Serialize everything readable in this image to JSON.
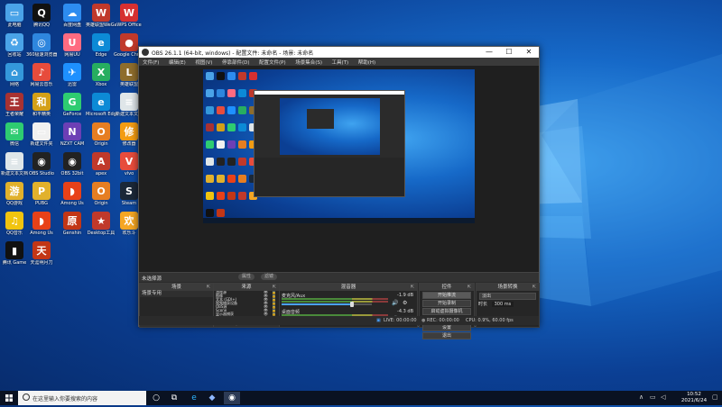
{
  "desktop": {
    "icons": [
      {
        "label": "此电脑",
        "icon": "computer-icon",
        "color": "#4aa3e8",
        "glyph": "▭"
      },
      {
        "label": "腾讯QQ",
        "icon": "qq-icon",
        "color": "#111111",
        "glyph": "Q"
      },
      {
        "label": "百度网盘",
        "icon": "baidu-netdisk-icon",
        "color": "#2d8cf0",
        "glyph": "☁"
      },
      {
        "label": "英雄联盟WeGame版",
        "icon": "wegame-icon",
        "color": "#c0392b",
        "glyph": "W"
      },
      {
        "label": "WPS Office",
        "icon": "wps-icon",
        "color": "#d63031",
        "glyph": "W"
      },
      {
        "label": "回收站",
        "icon": "recycle-bin-icon",
        "color": "#4aa3e8",
        "glyph": "♻"
      },
      {
        "label": "360极速浏览器",
        "icon": "browser-360-icon",
        "color": "#2e86de",
        "glyph": "◎"
      },
      {
        "label": "网易UU",
        "icon": "uu-icon",
        "color": "#ff6b81",
        "glyph": "U"
      },
      {
        "label": "Edge",
        "icon": "edge-icon",
        "color": "#0c8ad6",
        "glyph": "e"
      },
      {
        "label": "Google Chrome",
        "icon": "chrome-icon",
        "color": "#c0392b",
        "glyph": "●"
      },
      {
        "label": "网络",
        "icon": "network-icon",
        "color": "#3498db",
        "glyph": "⌂"
      },
      {
        "label": "网易云音乐",
        "icon": "netease-music-icon",
        "color": "#e74c3c",
        "glyph": "♪"
      },
      {
        "label": "迅雷",
        "icon": "thunder-icon",
        "color": "#1e90ff",
        "glyph": "✈"
      },
      {
        "label": "Xbox",
        "icon": "xbox-icon",
        "color": "#27ae60",
        "glyph": "X"
      },
      {
        "label": "英雄联盟",
        "icon": "lol-icon",
        "color": "#8e6d2c",
        "glyph": "L"
      },
      {
        "label": "王者荣耀",
        "icon": "honor-icon",
        "color": "#a83232",
        "glyph": "王"
      },
      {
        "label": "和平精英",
        "icon": "peace-elite-icon",
        "color": "#d4a017",
        "glyph": "和"
      },
      {
        "label": "GeForce",
        "icon": "geforce-icon",
        "color": "#2ecc71",
        "glyph": "G"
      },
      {
        "label": "Microsoft Edge",
        "icon": "edge-icon-2",
        "color": "#0c8ad6",
        "glyph": "e"
      },
      {
        "label": "新建文本文档",
        "icon": "text-file-icon",
        "color": "#dfe6e9",
        "glyph": "≡"
      },
      {
        "label": "微信",
        "icon": "wechat-icon",
        "color": "#2ecc71",
        "glyph": "✉"
      },
      {
        "label": "新建文件夹",
        "icon": "folder-icon",
        "color": "#f0f0f0",
        "glyph": "▭"
      },
      {
        "label": "NZXT CAM",
        "icon": "nzxt-icon",
        "color": "#6c3fb5",
        "glyph": "N"
      },
      {
        "label": "Origin",
        "icon": "origin-icon",
        "color": "#e67e22",
        "glyph": "O"
      },
      {
        "label": "修改器",
        "icon": "trainer-icon",
        "color": "#f39c12",
        "glyph": "修"
      },
      {
        "label": "新建文本文档",
        "icon": "text-file-icon-2",
        "color": "#dfe6e9",
        "glyph": "≡"
      },
      {
        "label": "OBS Studio",
        "icon": "obs-icon",
        "color": "#222222",
        "glyph": "◉"
      },
      {
        "label": "OBS 32bit",
        "icon": "obs-icon-2",
        "color": "#222222",
        "glyph": "◉"
      },
      {
        "label": "apex",
        "icon": "apex-icon",
        "color": "#c0392b",
        "glyph": "A"
      },
      {
        "label": "vivo",
        "icon": "game-icon",
        "color": "#e74c3c",
        "glyph": "V"
      },
      {
        "label": "QQ游戏",
        "icon": "qq-game-icon",
        "color": "#e1b12c",
        "glyph": "游"
      },
      {
        "label": "PUBG",
        "icon": "pubg-icon",
        "color": "#e1b12c",
        "glyph": "P"
      },
      {
        "label": "Among Us",
        "icon": "among-us-icon",
        "color": "#e84118",
        "glyph": "◗"
      },
      {
        "label": "Origin",
        "icon": "origin-icon-2",
        "color": "#e67e22",
        "glyph": "O"
      },
      {
        "label": "Steam",
        "icon": "steam-icon",
        "color": "#1b2838",
        "glyph": "S"
      },
      {
        "label": "QQ音乐",
        "icon": "qq-music-icon",
        "color": "#f1c40f",
        "glyph": "♫"
      },
      {
        "label": "Among Us",
        "icon": "among-us-icon-2",
        "color": "#e84118",
        "glyph": "◗"
      },
      {
        "label": "Genshin",
        "icon": "genshin-icon",
        "color": "#c23616",
        "glyph": "原"
      },
      {
        "label": "Desktop工具",
        "icon": "tool-icon",
        "color": "#c0392b",
        "glyph": "★"
      },
      {
        "label": "欢乐斗",
        "icon": "game-icon-2",
        "color": "#f5a623",
        "glyph": "欢"
      },
      {
        "label": "腾讯 Game",
        "icon": "tencent-game-icon",
        "color": "#111111",
        "glyph": "▮"
      },
      {
        "label": "天涯明月刀",
        "icon": "game-icon-3",
        "color": "#c23616",
        "glyph": "天"
      }
    ]
  },
  "obs": {
    "title": "OBS 26.1.1 (64-bit, windows) - 配置文件: 未命名 - 场景: 未命名",
    "minimize": "—",
    "maximize": "☐",
    "close": "✕",
    "menu": [
      "文件(F)",
      "编辑(E)",
      "视图(V)",
      "停靠部件(D)",
      "配置文件(P)",
      "场景集合(S)",
      "工具(T)",
      "帮助(H)"
    ],
    "no_source": "未选择源",
    "props_btn": "属性",
    "filters_btn": "滤镜",
    "docks": {
      "scenes": {
        "title": "场景",
        "items": [
          "场景专用"
        ]
      },
      "sources": {
        "title": "来源",
        "items": [
          "游戏源",
          "图像",
          "文本 (GDI+)",
          "视频捕获设备",
          "OBS源",
          "Scene",
          "显示器捕获",
          "窗口"
        ]
      },
      "mixer": {
        "title": "混音器",
        "tracks": [
          {
            "name": "麦克风/Aux",
            "db": "-1.9 dB",
            "level": 0.78
          },
          {
            "name": "桌面音频",
            "db": "-4.3 dB",
            "level": 0.62
          }
        ]
      },
      "transitions": {
        "title": "场景转换",
        "type": "淡出",
        "duration_label": "时长",
        "duration": "300 ms"
      },
      "controls": {
        "title": "控件",
        "buttons": [
          "开始推流",
          "开始录制",
          "启动虚拟摄像机",
          "工作室模式",
          "设置",
          "退出"
        ]
      }
    },
    "status": {
      "live": "LIVE: 00:00:00",
      "rec": "REC: 00:00:00",
      "cpu": "CPU: 0.9%, 60.00 fps"
    },
    "toolbar": {
      "add": "+",
      "remove": "−",
      "up": "∧",
      "down": "∨",
      "gear": "⚙"
    }
  },
  "taskbar": {
    "search_placeholder": "在这里输入你要搜索的内容",
    "time": "10:52",
    "date": "2021/6/24"
  }
}
